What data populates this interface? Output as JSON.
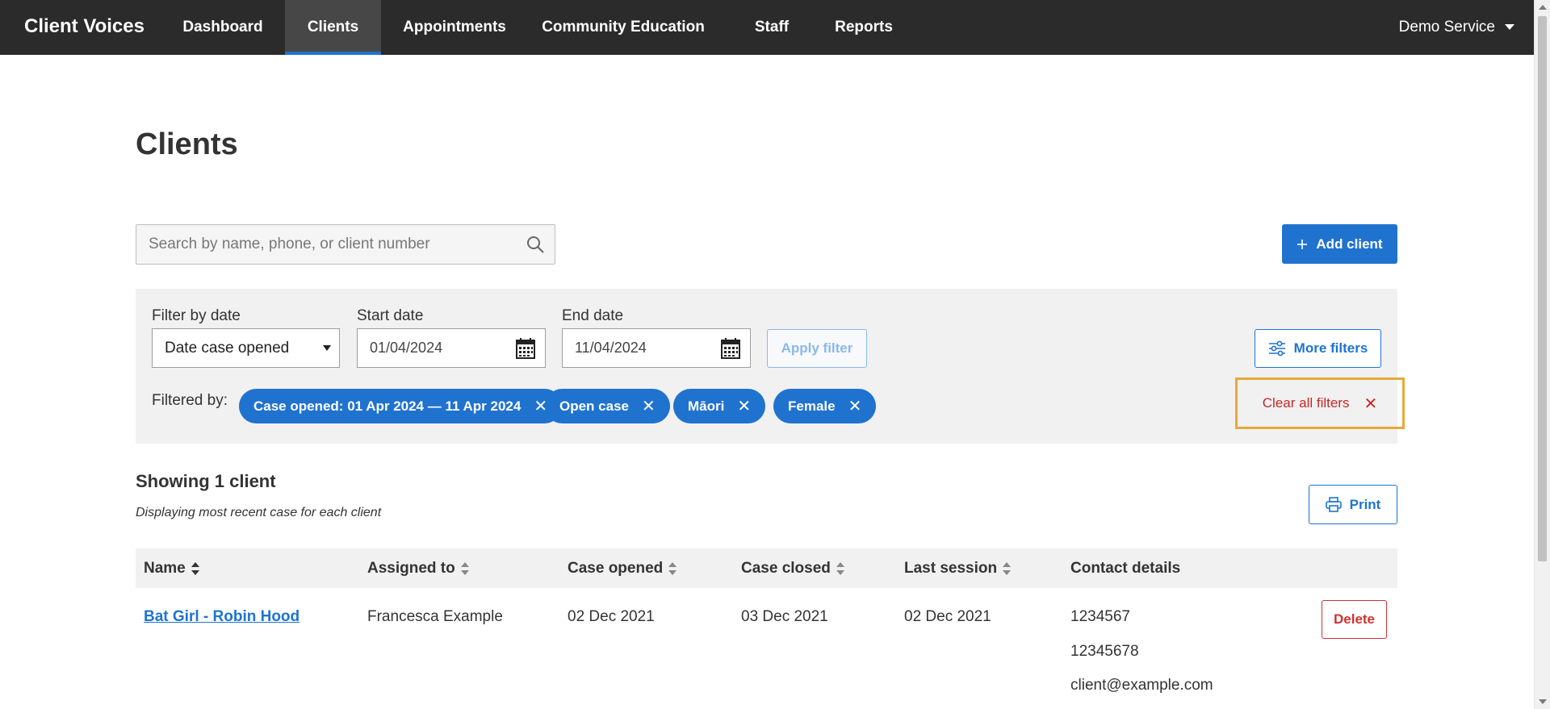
{
  "nav": {
    "brand": "Client Voices",
    "items": [
      {
        "label": "Dashboard"
      },
      {
        "label": "Clients"
      },
      {
        "label": "Appointments"
      },
      {
        "label": "Community Education"
      },
      {
        "label": "Staff"
      },
      {
        "label": "Reports"
      }
    ],
    "active": "Clients",
    "account": "Demo Service"
  },
  "page": {
    "title": "Clients"
  },
  "search": {
    "placeholder": "Search by name, phone, or client number",
    "value": ""
  },
  "actions": {
    "add_client": "Add client"
  },
  "filters": {
    "filter_by_label": "Filter by date",
    "filter_by_value": "Date case opened",
    "start_label": "Start date",
    "start_value": "01/04/2024",
    "end_label": "End date",
    "end_value": "11/04/2024",
    "apply": "Apply filter",
    "more": "More filters",
    "filtered_by_label": "Filtered by:",
    "chips": [
      {
        "label": "Case opened: 01 Apr 2024 — 11 Apr 2024"
      },
      {
        "label": "Open case"
      },
      {
        "label": "Māori"
      },
      {
        "label": "Female"
      }
    ],
    "clear_all": "Clear all filters"
  },
  "results": {
    "showing": "Showing 1 client",
    "note": "Displaying most recent case for each client",
    "print": "Print"
  },
  "table": {
    "columns": [
      "Name",
      "Assigned to",
      "Case opened",
      "Case closed",
      "Last session",
      "Contact details"
    ],
    "rows": [
      {
        "name": "Bat Girl - Robin Hood",
        "assigned_to": "Francesca Example",
        "case_opened": "02 Dec 2021",
        "case_closed": "03 Dec 2021",
        "last_session": "02 Dec 2021",
        "contact": [
          "1234567",
          "12345678",
          "client@example.com"
        ],
        "delete": "Delete"
      }
    ]
  },
  "colors": {
    "primary": "#1f73cf",
    "nav_bg": "#2b2b2b",
    "danger": "#d32f2f",
    "highlight": "#e8a93a"
  }
}
